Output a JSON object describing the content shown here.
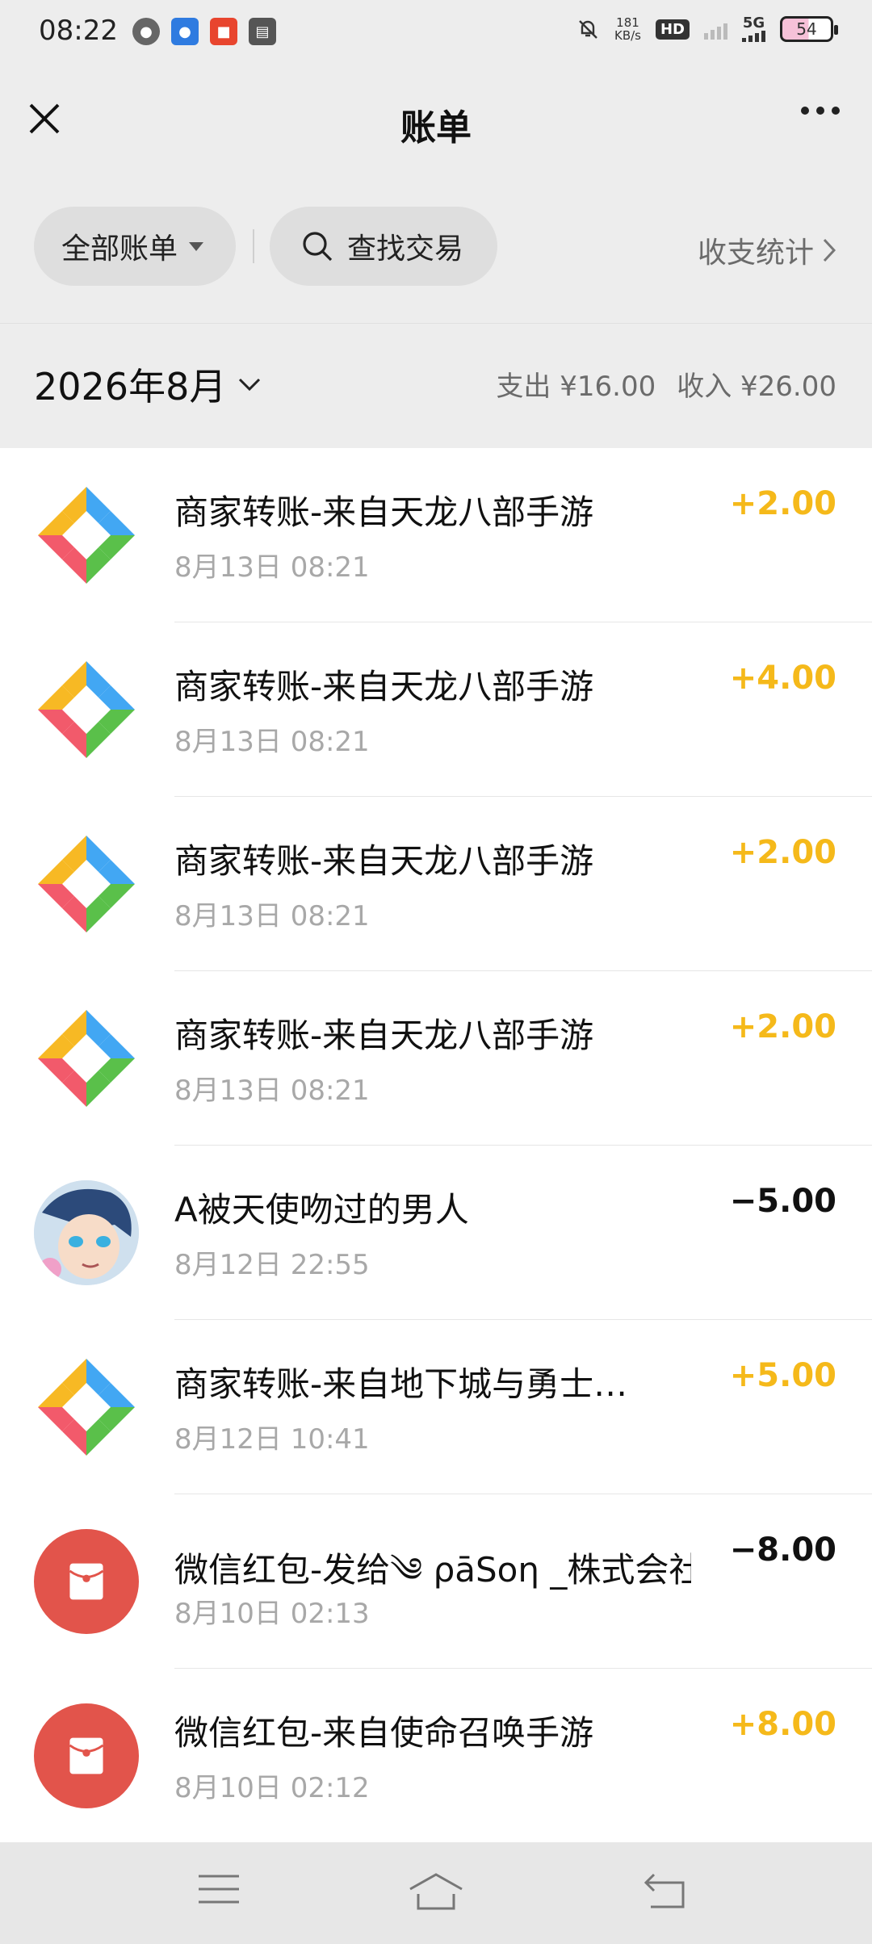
{
  "status": {
    "time": "08:22",
    "speed_value": "181",
    "speed_unit": "KB/s",
    "hd": "HD",
    "net": "5G",
    "battery": "54"
  },
  "nav": {
    "title": "账单"
  },
  "filter": {
    "all_label": "全部账单",
    "search_label": "查找交易",
    "stats_label": "收支统计"
  },
  "summary": {
    "month": "2026年8月",
    "expense": "支出 ¥16.00",
    "income": "收入 ¥26.00"
  },
  "transactions": [
    {
      "title": "商家转账-来自天龙八部手游",
      "time": "8月13日 08:21",
      "amount": "+2.00",
      "type": "income",
      "icon": "merchant-icon"
    },
    {
      "title": "商家转账-来自天龙八部手游",
      "time": "8月13日 08:21",
      "amount": "+4.00",
      "type": "income",
      "icon": "merchant-icon"
    },
    {
      "title": "商家转账-来自天龙八部手游",
      "time": "8月13日 08:21",
      "amount": "+2.00",
      "type": "income",
      "icon": "merchant-icon"
    },
    {
      "title": "商家转账-来自天龙八部手游",
      "time": "8月13日 08:21",
      "amount": "+2.00",
      "type": "income",
      "icon": "merchant-icon"
    },
    {
      "title": "A被天使吻过的男人",
      "time": "8月12日 22:55",
      "amount": "−5.00",
      "type": "expense",
      "icon": "avatar"
    },
    {
      "title": "商家转账-来自地下城与勇士…",
      "time": "8月12日 10:41",
      "amount": "+5.00",
      "type": "income",
      "icon": "merchant-icon"
    },
    {
      "title": "微信红包-发给༄ ρāSoη _株式会社",
      "time": "8月10日 02:13",
      "amount": "−8.00",
      "type": "expense",
      "icon": "red-packet-icon"
    },
    {
      "title": "微信红包-来自使命召唤手游",
      "time": "8月10日 02:12",
      "amount": "+8.00",
      "type": "income",
      "icon": "red-packet-icon"
    }
  ],
  "colors": {
    "income": "#f5b91a",
    "expense": "#111111",
    "red_packet": "#e2544b"
  }
}
